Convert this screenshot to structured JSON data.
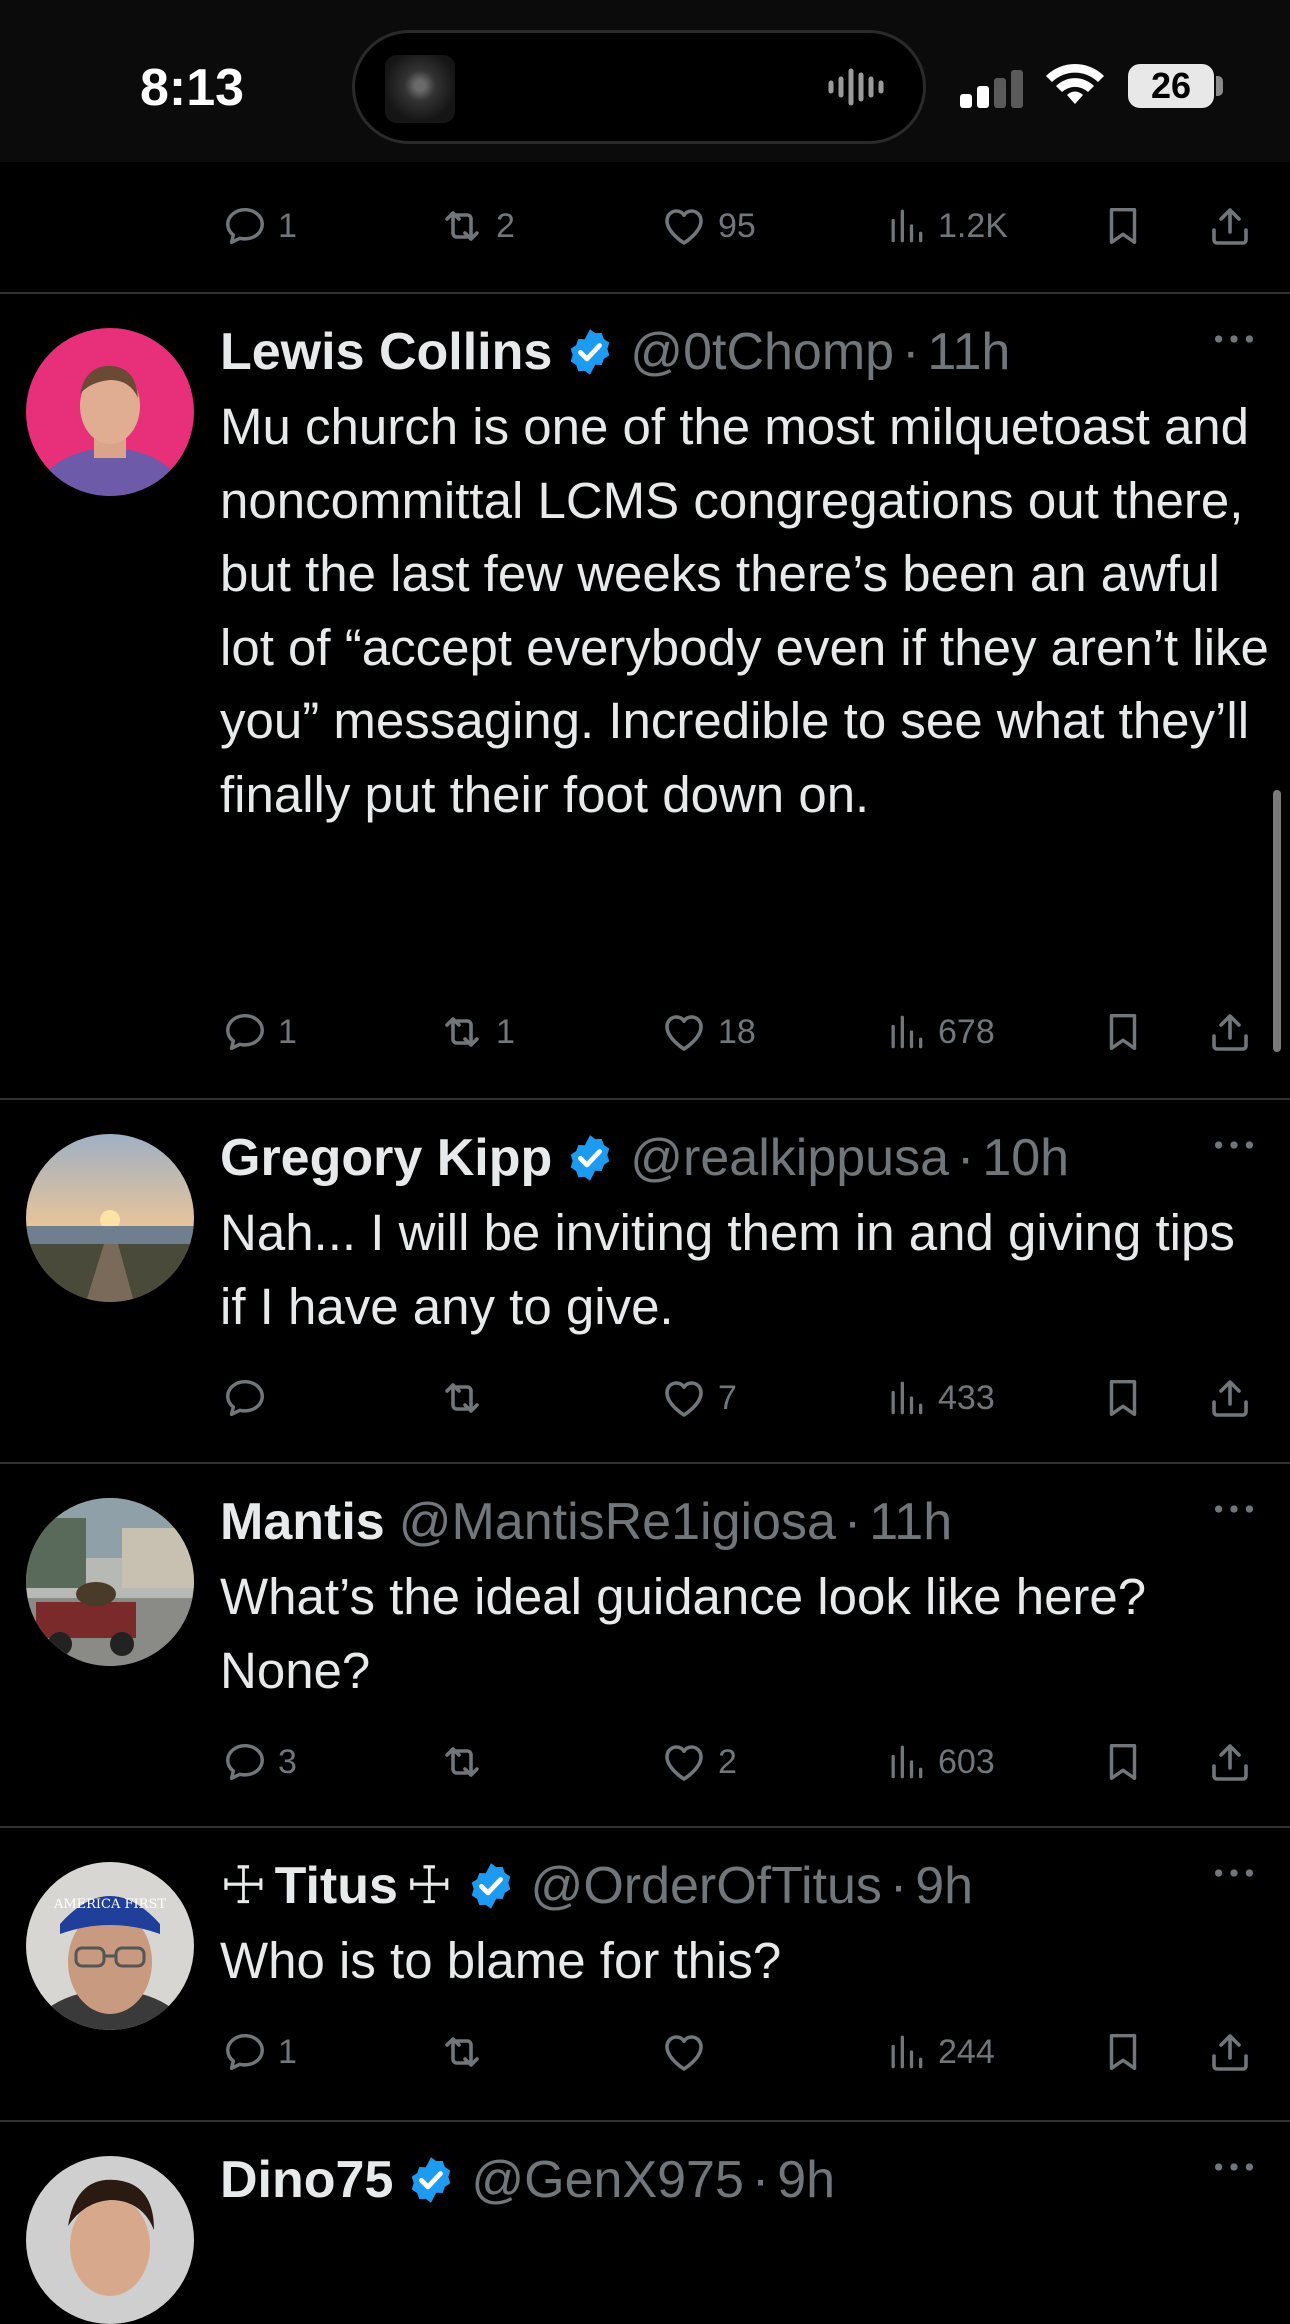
{
  "status_bar": {
    "time": "8:13",
    "battery": "26"
  },
  "top_actions": {
    "replies": "1",
    "reposts": "2",
    "likes": "95",
    "views": "1.2K"
  },
  "posts": [
    {
      "name": "Lewis Collins",
      "verified": true,
      "handle": "@0tChomp",
      "time": "11h",
      "text": "Mu church is one of the most milquetoast and noncommittal LCMS congregations out there, but the last few weeks there’s been an awful lot of “accept everybody even if they aren’t like you” messaging. Incredible to see what they’ll finally put their foot down on.",
      "replies": "1",
      "reposts": "1",
      "likes": "18",
      "views": "678"
    },
    {
      "name": "Gregory Kipp",
      "verified": true,
      "handle": "@realkippusa",
      "time": "10h",
      "text": "Nah... I will be inviting them in and giving tips if I have any to give.",
      "replies": "",
      "reposts": "",
      "likes": "7",
      "views": "433"
    },
    {
      "name": "Mantis",
      "verified": false,
      "handle": "@MantisRe1igiosa",
      "time": "11h",
      "text": "What’s the ideal guidance look like here? None?",
      "replies": "3",
      "reposts": "",
      "likes": "2",
      "views": "603"
    },
    {
      "name_prefix": "☩",
      "name": "Titus",
      "name_suffix": "☩",
      "verified": true,
      "handle": "@OrderOfTitus",
      "time": "9h",
      "text": "Who is to blame for this?",
      "replies": "1",
      "reposts": "",
      "likes": "",
      "views": "244",
      "avatar_hat_text": "AMERICA FIRST"
    },
    {
      "name": "Dino75",
      "verified": true,
      "handle": "@GenX975",
      "time": "9h"
    }
  ],
  "colors": {
    "accent": "#1d9bf0",
    "muted": "#71767b",
    "text": "#e7e9ea",
    "divider": "#2f3336"
  },
  "icons": [
    "reply-icon",
    "repost-icon",
    "like-icon",
    "views-icon",
    "bookmark-icon",
    "share-icon",
    "more-icon",
    "verified-badge-icon"
  ]
}
